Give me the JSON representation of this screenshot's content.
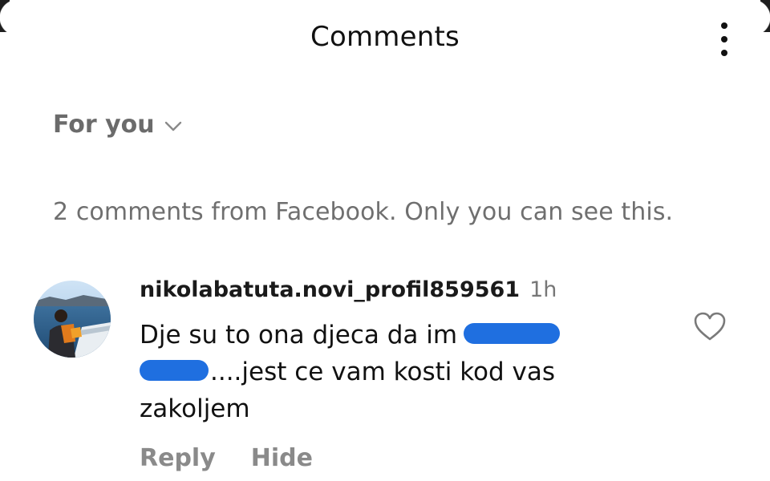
{
  "header": {
    "title": "Comments",
    "menu_icon": "more-vertical-icon"
  },
  "filter": {
    "label": "For you",
    "icon": "chevron-down-icon"
  },
  "notice": {
    "text": "2 comments from Facebook. Only you can see this."
  },
  "comments": [
    {
      "username": "nikolabatuta.novi_profil859561",
      "time": "1h",
      "text_part1": "Dje su to ona djeca da im",
      "text_part2": "....jest ce vam kosti kod vas",
      "text_part3": "zakoljem",
      "redaction_color": "#1f6fe0",
      "avatar_icon": "profile-photo",
      "like_icon": "heart-outline-icon",
      "reply_label": "Reply",
      "hide_label": "Hide"
    }
  ],
  "colors": {
    "background": "#ffffff",
    "primary_text": "#111111",
    "secondary_text": "#6f6f6f",
    "action_text": "#8a8a8a"
  }
}
